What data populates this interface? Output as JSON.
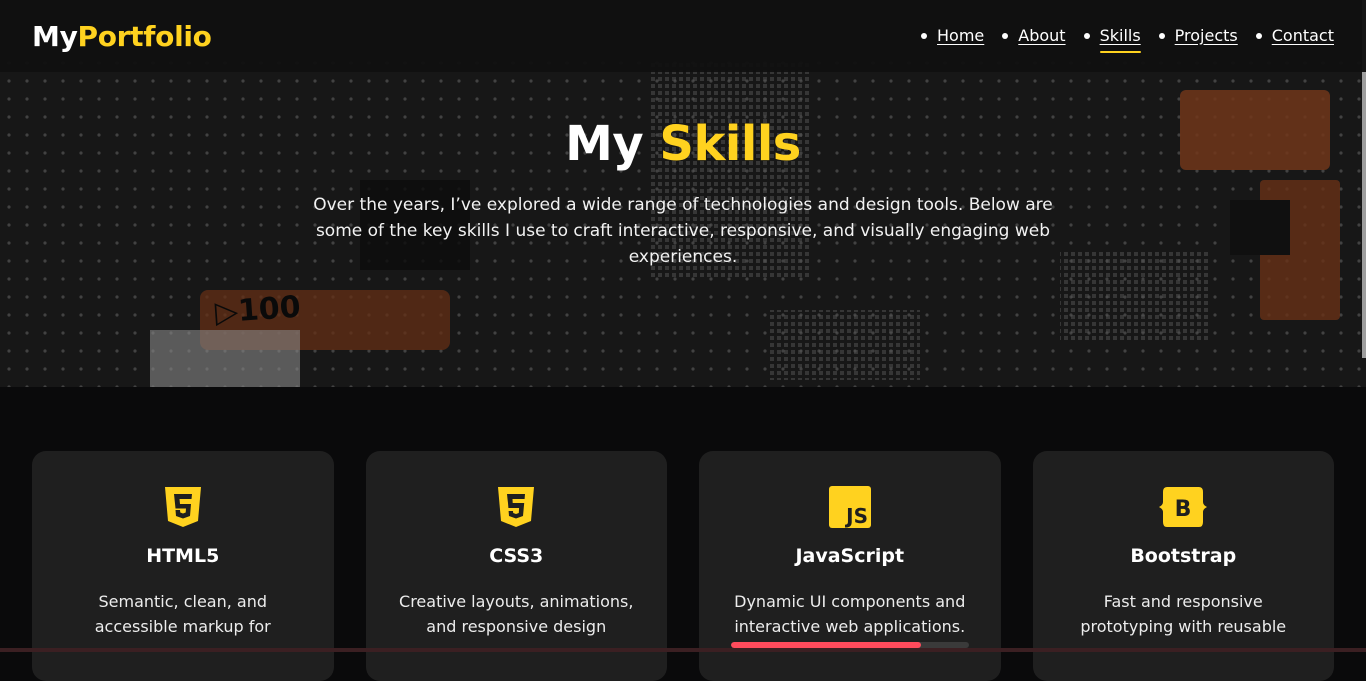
{
  "brand": {
    "part1": "My",
    "part2": "Portfolio"
  },
  "nav": [
    {
      "label": "Home"
    },
    {
      "label": "About"
    },
    {
      "label": "Skills",
      "active": true
    },
    {
      "label": "Projects"
    },
    {
      "label": "Contact"
    }
  ],
  "hero": {
    "title_part1": "My",
    "title_part2": "Skills",
    "description": "Over the years, I’ve explored a wide range of technologies and design tools. Below are some of the key skills I use to craft interactive, responsive, and visually engaging web experiences."
  },
  "skills": [
    {
      "icon": "html5-icon",
      "title": "HTML5",
      "desc": "Semantic, clean, and accessible markup for"
    },
    {
      "icon": "css3-icon",
      "title": "CSS3",
      "desc": "Creative layouts, animations, and responsive design"
    },
    {
      "icon": "javascript-icon",
      "title": "JavaScript",
      "desc": "Dynamic UI components and interactive web applications."
    },
    {
      "icon": "bootstrap-icon",
      "title": "Bootstrap",
      "desc": "Fast and responsive prototyping with reusable"
    }
  ],
  "progress": {
    "value": 0.8
  },
  "colors": {
    "accent": "#ffd21f",
    "card_bg": "#1f1f1f",
    "page_bg": "#0a0a0b",
    "progress": "#ff4b5c"
  }
}
